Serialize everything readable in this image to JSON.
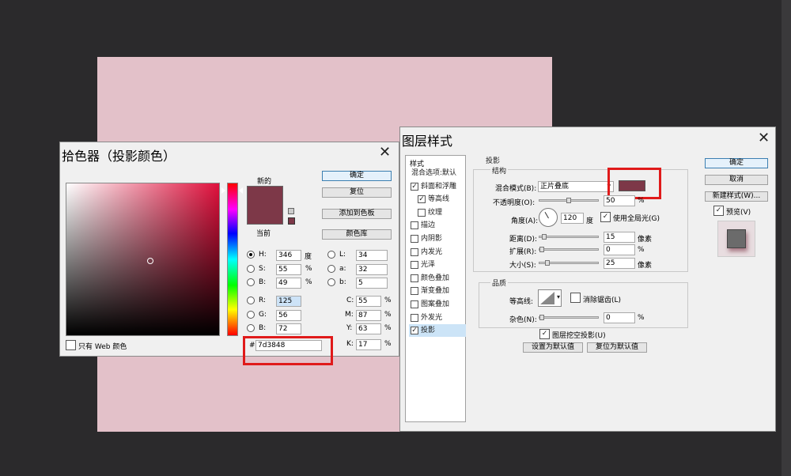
{
  "color_picker": {
    "title": "拾色器（投影颜色）",
    "new_label": "新的",
    "current_label": "当前",
    "new_color": "#7d3848",
    "current_color": "#7d3848",
    "buttons": {
      "ok": "确定",
      "reset": "复位",
      "add_to_swatches": "添加到色板",
      "color_libraries": "颜色库"
    },
    "web_only_label": "只有 Web 颜色",
    "hsb": {
      "h_label": "H:",
      "h": "346",
      "h_unit": "度",
      "s_label": "S:",
      "s": "55",
      "s_unit": "%",
      "b_label": "B:",
      "b": "49",
      "b_unit": "%"
    },
    "rgb": {
      "r_label": "R:",
      "r": "125",
      "g_label": "G:",
      "g": "56",
      "b_label": "B:",
      "b": "72"
    },
    "lab": {
      "l_label": "L:",
      "l": "34",
      "a_label": "a:",
      "a": "32",
      "b_label": "b:",
      "b": "5"
    },
    "cmyk": {
      "c_label": "C:",
      "c": "55",
      "m_label": "M:",
      "m": "87",
      "y_label": "Y:",
      "y": "63",
      "k_label": "K:",
      "k": "17",
      "unit": "%"
    },
    "hex_label": "#",
    "hex": "7d3848"
  },
  "layer_style": {
    "title": "图层样式",
    "sidebar": {
      "header": "样式",
      "items": [
        {
          "label": "混合选项:默认",
          "check": false
        },
        {
          "label": "斜面和浮雕",
          "check": true,
          "checked": true
        },
        {
          "label": "等高线",
          "check": true,
          "checked": true,
          "indent": true
        },
        {
          "label": "纹理",
          "check": true,
          "checked": false,
          "indent": true
        },
        {
          "label": "描边",
          "check": true,
          "checked": false
        },
        {
          "label": "内阴影",
          "check": true,
          "checked": false
        },
        {
          "label": "内发光",
          "check": true,
          "checked": false
        },
        {
          "label": "光泽",
          "check": true,
          "checked": false
        },
        {
          "label": "颜色叠加",
          "check": true,
          "checked": false
        },
        {
          "label": "渐变叠加",
          "check": true,
          "checked": false
        },
        {
          "label": "图案叠加",
          "check": true,
          "checked": false
        },
        {
          "label": "外发光",
          "check": true,
          "checked": false
        },
        {
          "label": "投影",
          "check": true,
          "checked": true,
          "selected": true
        }
      ]
    },
    "section_title": "投影",
    "structure": {
      "title": "结构",
      "blend_mode_label": "混合模式(B):",
      "blend_mode": "正片叠底",
      "shadow_color": "#7d3848",
      "opacity_label": "不透明度(O):",
      "opacity": "50",
      "opacity_level": 0.5,
      "angle_label": "角度(A):",
      "angle": "120",
      "angle_unit": "度",
      "global_light_label": "使用全局光(G)",
      "distance_label": "距离(D):",
      "distance": "15",
      "distance_level": 0.05,
      "spread_label": "扩展(R):",
      "spread": "0",
      "spread_level": 0.0,
      "size_label": "大小(S):",
      "size": "25",
      "size_level": 0.1,
      "px_unit": "像素",
      "pct_unit": "%"
    },
    "quality": {
      "title": "品质",
      "contour_label": "等高线:",
      "antialias_label": "消除锯齿(L)",
      "noise_label": "杂色(N):",
      "noise": "0",
      "noise_level": 0.0,
      "knockout_label": "图层挖空投影(U)"
    },
    "buttons": {
      "make_default": "设置为默认值",
      "reset_default": "复位为默认值",
      "ok": "确定",
      "cancel": "取消",
      "new_style": "新建样式(W)...",
      "preview": "预览(V)"
    }
  }
}
